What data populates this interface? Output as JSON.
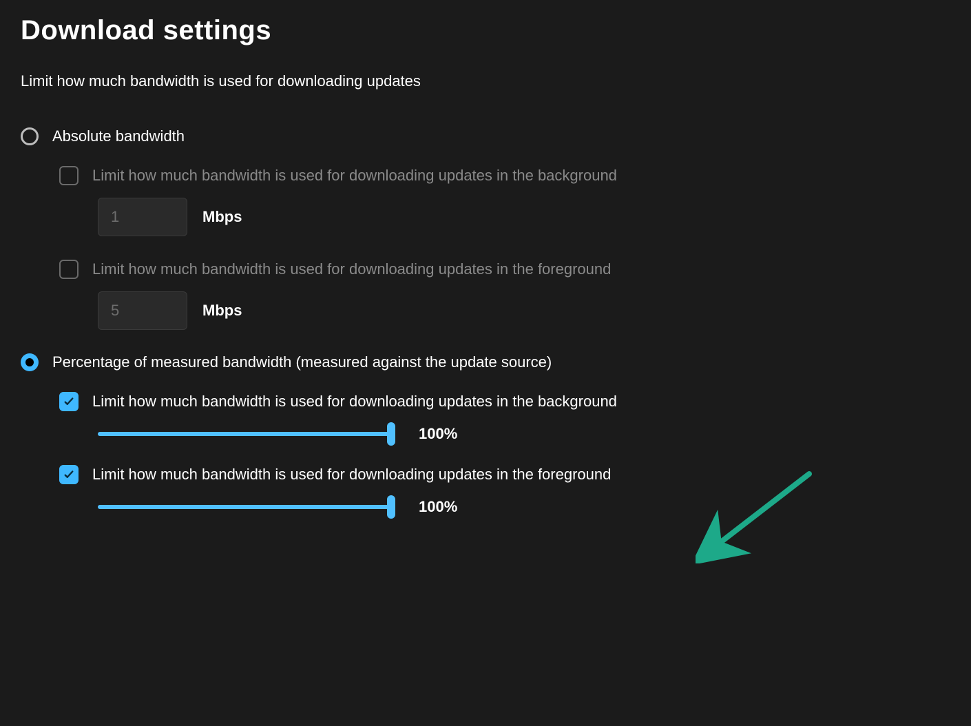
{
  "title": "Download settings",
  "subtitle": "Limit how much bandwidth is used for downloading updates",
  "options": {
    "absolute": {
      "label": "Absolute bandwidth",
      "selected": false,
      "bg": {
        "label": "Limit how much bandwidth is used for downloading updates in the background",
        "checked": false,
        "value": "1",
        "unit": "Mbps"
      },
      "fg": {
        "label": "Limit how much bandwidth is used for downloading updates in the foreground",
        "checked": false,
        "value": "5",
        "unit": "Mbps"
      }
    },
    "percentage": {
      "label": "Percentage of measured bandwidth (measured against the update source)",
      "selected": true,
      "bg": {
        "label": "Limit how much bandwidth is used for downloading updates in the background",
        "checked": true,
        "value": 100,
        "display": "100%"
      },
      "fg": {
        "label": "Limit how much bandwidth is used for downloading updates in the foreground",
        "checked": true,
        "value": 100,
        "display": "100%"
      }
    }
  },
  "annotation": {
    "type": "arrow",
    "color": "#1da989",
    "target": "percentage-foreground-option"
  }
}
